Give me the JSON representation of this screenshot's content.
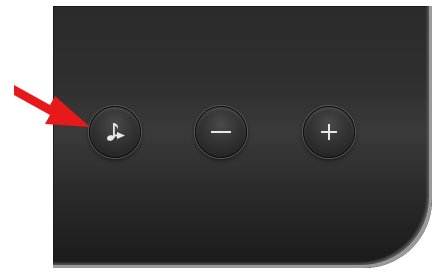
{
  "device": {
    "buttons": [
      {
        "id": "playlist",
        "icon": "music-note-play-icon"
      },
      {
        "id": "volume-down",
        "icon": "minus-icon"
      },
      {
        "id": "volume-up",
        "icon": "plus-icon"
      }
    ],
    "icon_color": "#e8e8e8"
  },
  "annotation": {
    "arrow_color": "#e8191a",
    "points_to": "playlist"
  }
}
